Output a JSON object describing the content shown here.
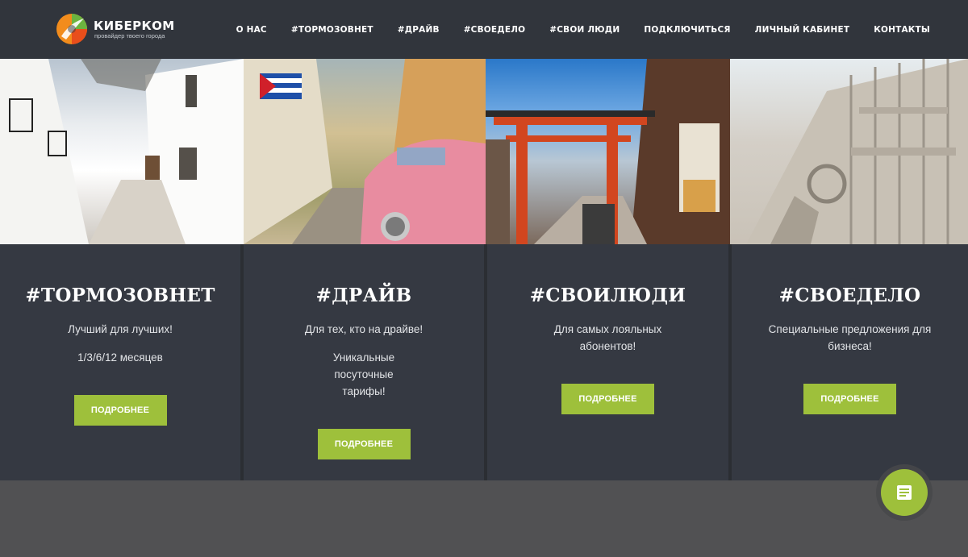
{
  "brand": {
    "name": "КИБЕРКОМ",
    "tagline": "провайдер твоего города"
  },
  "nav": [
    {
      "label": "О НАС"
    },
    {
      "label": "#ТОРМОЗОВНЕТ"
    },
    {
      "label": "#ДРАЙВ"
    },
    {
      "label": "#СВОЕДЕЛО"
    },
    {
      "label": "#СВОИ ЛЮДИ"
    },
    {
      "label": "ПОДКЛЮЧИТЬСЯ"
    },
    {
      "label": "ЛИЧНЫЙ КАБИНЕТ"
    },
    {
      "label": "КОНТАКТЫ"
    }
  ],
  "cards": [
    {
      "title": "#ТОРМОЗОВНЕТ",
      "lines": [
        "Лучший для лучших!",
        "1/3/6/12 месяцев"
      ],
      "button": "ПОДРОБНЕЕ"
    },
    {
      "title": "#ДРАЙВ",
      "lines": [
        "Для тех, кто на драйве!",
        "Уникальные посуточные тарифы!"
      ],
      "button": "ПОДРОБНЕЕ"
    },
    {
      "title": "#СВОИЛЮДИ",
      "lines": [
        "Для самых лояльных абонентов!"
      ],
      "button": "ПОДРОБНЕЕ"
    },
    {
      "title": "#СВОЕДЕЛО",
      "lines": [
        "Специальные предложения для бизнеса!"
      ],
      "button": "ПОДРОБНЕЕ"
    }
  ],
  "photos": [
    "white-village-street",
    "havana-street-pink-car",
    "japan-torii-street",
    "gothic-cathedral-facade"
  ],
  "colors": {
    "header_bg": "#31353c",
    "card_bg": "#353942",
    "accent": "#9ec03b",
    "footer_bg": "#515153"
  },
  "icons": {
    "chat": "chat-widget-icon"
  }
}
